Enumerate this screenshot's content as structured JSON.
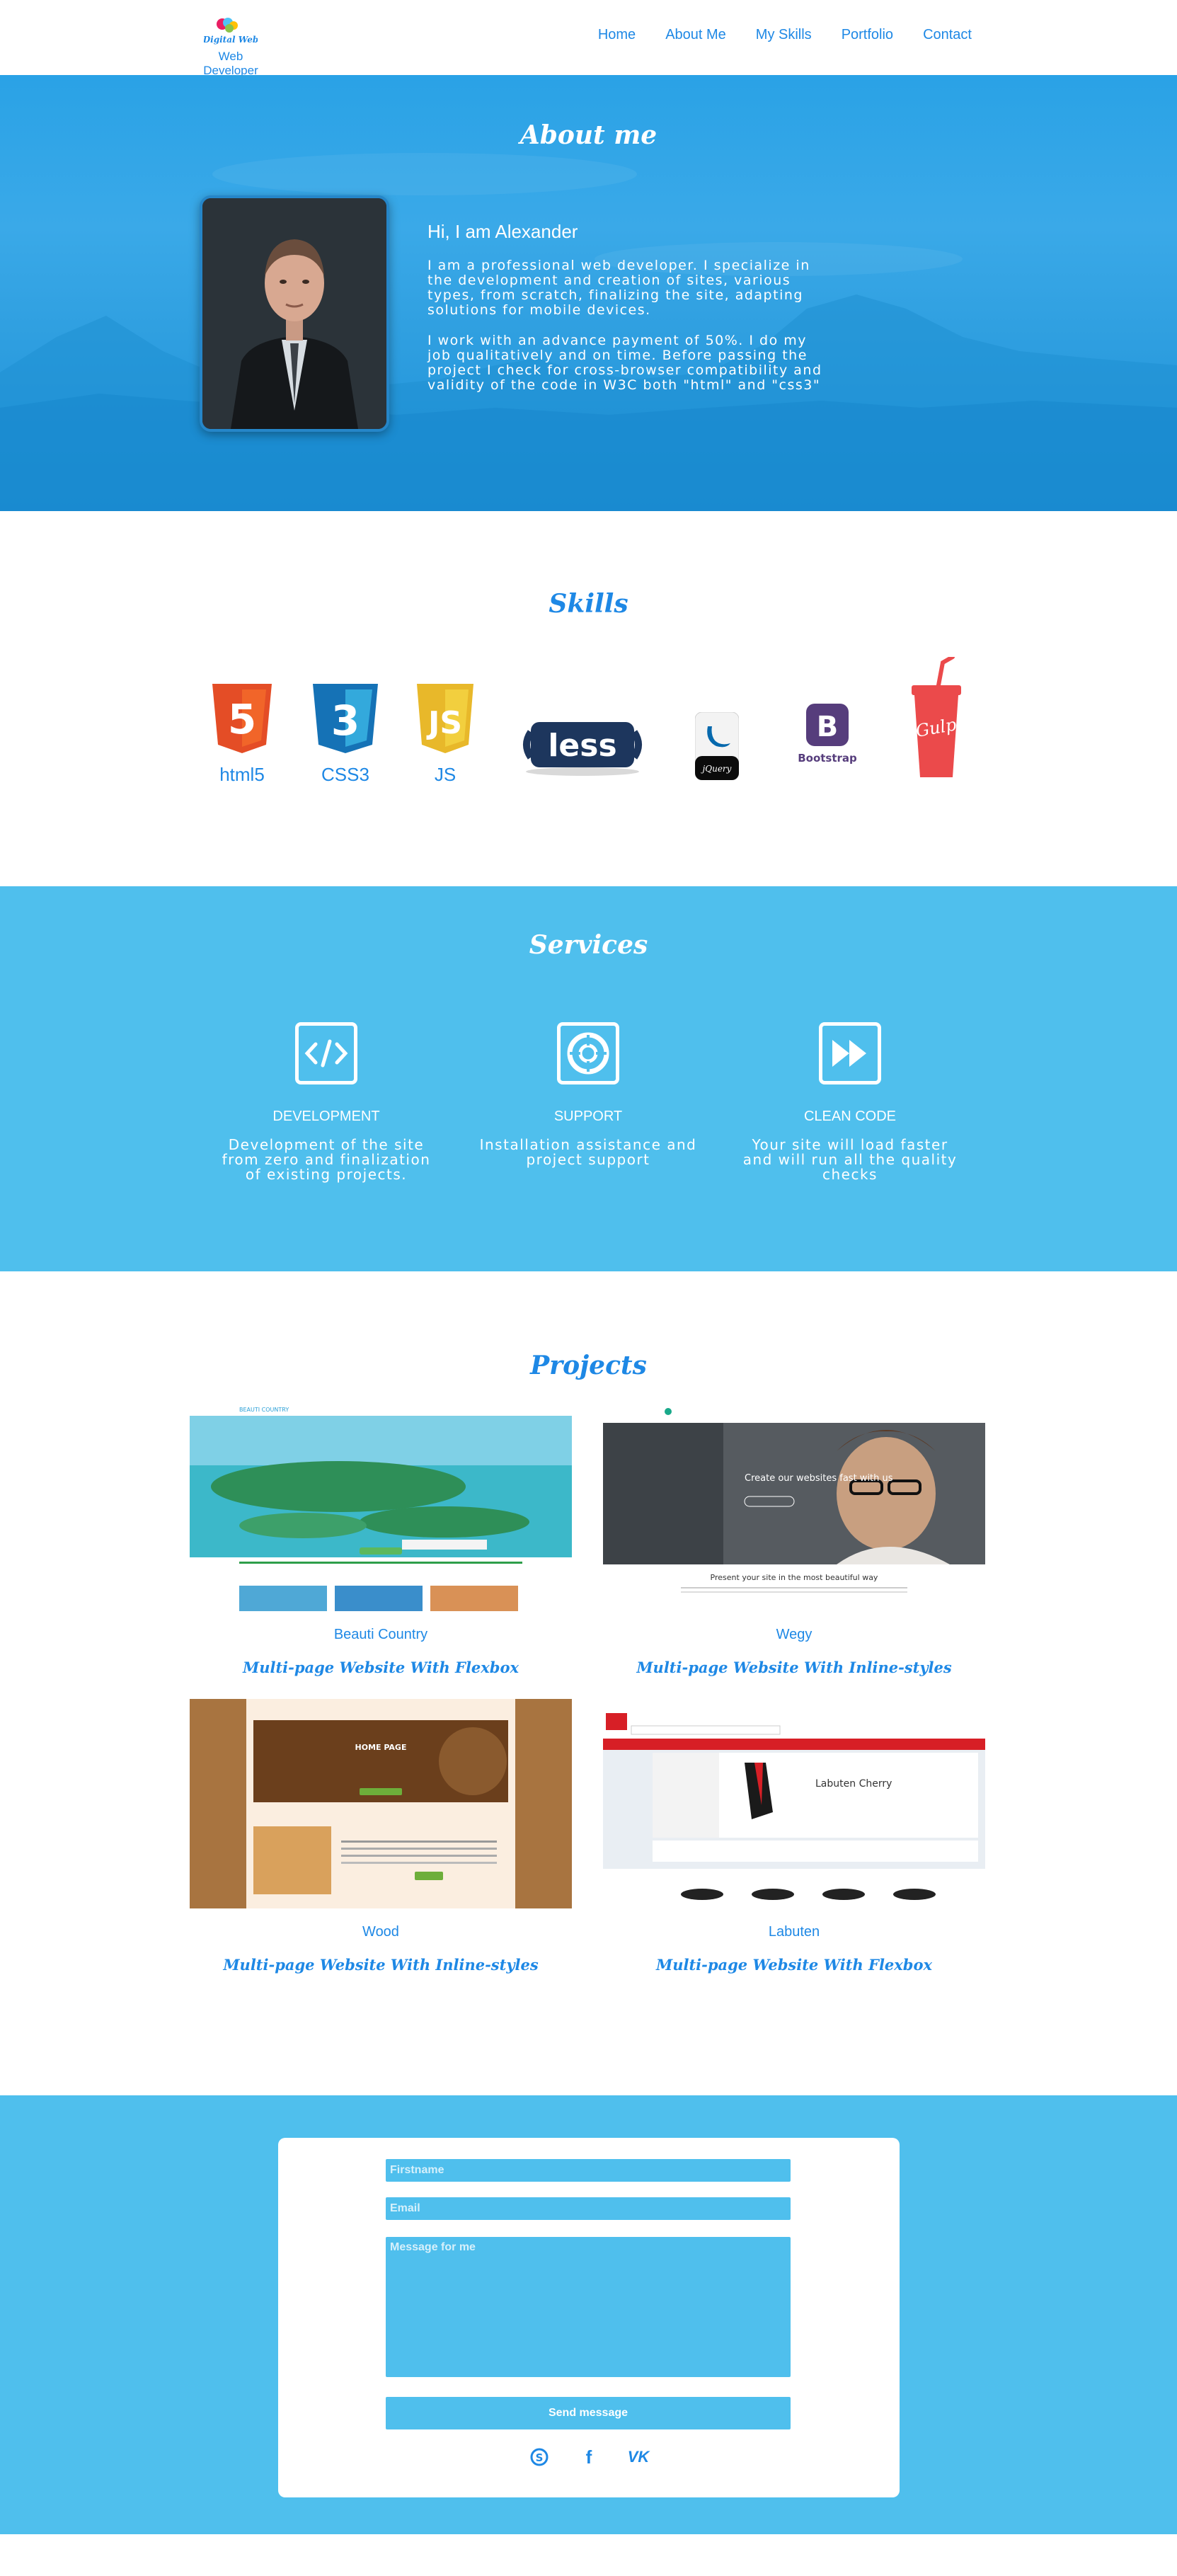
{
  "header": {
    "logo_text": "Digital Web",
    "subtitle": "Web Developer",
    "nav": [
      "Home",
      "About Me",
      "My Skills",
      "Portfolio",
      "Contact"
    ]
  },
  "about": {
    "title": "About me",
    "greeting": "Hi, I am Alexander",
    "paragraphs": [
      "I am a professional web developer. I specialize in the development and creation of sites, various types, from scratch, finalizing the site, adapting solutions for mobile devices.",
      "I work with an advance payment of 50%. I do my job qualitatively and on time. Before passing the project I check for cross-browser compatibility and validity of the code in W3C both \"html\" and \"css3\""
    ]
  },
  "skills": {
    "title": "Skills",
    "items": [
      {
        "label": "html5",
        "icon": "html5-icon",
        "color": "#e44d26"
      },
      {
        "label": "CSS3",
        "icon": "css3-icon",
        "color": "#1572b6"
      },
      {
        "label": "JS",
        "icon": "js-icon",
        "color": "#e8b82a"
      },
      {
        "logo": "less",
        "icon": "less-icon",
        "color": "#1d365d"
      },
      {
        "logo": "jQuery",
        "icon": "jquery-icon",
        "color": "#0769ad"
      },
      {
        "logo": "Bootstrap",
        "icon": "bootstrap-icon",
        "color": "#563d7c"
      },
      {
        "logo": "Gulp",
        "icon": "gulp-icon",
        "color": "#eb4a4b"
      }
    ]
  },
  "services": {
    "title": "Services",
    "items": [
      {
        "title": "DEVELOPMENT",
        "desc": "Development of the site from zero and finalization of existing projects.",
        "icon": "code-icon"
      },
      {
        "title": "SUPPORT",
        "desc": "Installation assistance and project support",
        "icon": "lifebuoy-icon"
      },
      {
        "title": "CLEAN CODE",
        "desc": "Your site will load faster and will run all the quality checks",
        "icon": "fast-forward-icon"
      }
    ]
  },
  "projects": {
    "title": "Projects",
    "items": [
      {
        "name": "Beauti Country",
        "desc": "Multi-page Website With Flexbox",
        "thumb_caption": "BEAUTI COUNTRY"
      },
      {
        "name": "Wegy",
        "desc": "Multi-page Website With Inline-styles",
        "thumb_caption": "Create our websites fast with us",
        "thumb_sub": "Present your site in the most beautiful way"
      },
      {
        "name": "Wood",
        "desc": "Multi-page Website With Inline-styles",
        "thumb_caption": "HOME PAGE"
      },
      {
        "name": "Labuten",
        "desc": "Multi-page Website With Flexbox",
        "thumb_caption": "Labuten Cherry"
      }
    ]
  },
  "contact": {
    "firstname_placeholder": "Firstname",
    "email_placeholder": "Email",
    "message_placeholder": "Message for me",
    "send_label": "Send message",
    "socials": [
      {
        "name": "skype",
        "glyph": "S"
      },
      {
        "name": "facebook",
        "glyph": "f"
      },
      {
        "name": "vk",
        "glyph": "VK"
      }
    ]
  },
  "colors": {
    "accent": "#1e88e5",
    "sky": "#4fbfed"
  }
}
